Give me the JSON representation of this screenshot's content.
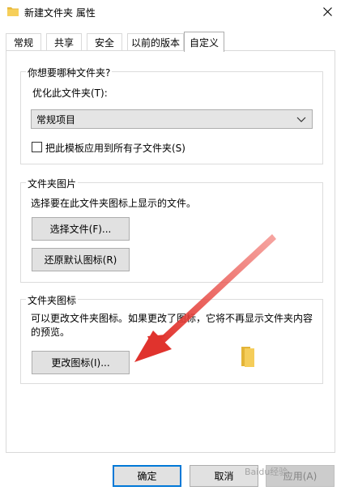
{
  "window": {
    "title": "新建文件夹 属性",
    "folder_icon": "folder-icon",
    "close_icon": "close-icon"
  },
  "tabs": [
    {
      "label": "常规",
      "active": false
    },
    {
      "label": "共享",
      "active": false
    },
    {
      "label": "安全",
      "active": false
    },
    {
      "label": "以前的版本",
      "active": false
    },
    {
      "label": "自定义",
      "active": true
    }
  ],
  "optimize": {
    "group_title": "你想要哪种文件夹?",
    "label": "优化此文件夹(T):",
    "selected": "常规项目",
    "checkbox_label": "把此模板应用到所有子文件夹(S)",
    "checked": false
  },
  "folder_pictures": {
    "group_title": "文件夹图片",
    "description": "选择要在此文件夹图标上显示的文件。",
    "choose_button": "选择文件(F)...",
    "restore_button": "还原默认图标(R)"
  },
  "folder_icons": {
    "group_title": "文件夹图标",
    "description_line1": "可以更改文件夹图标。如果更改了图标，它将不再显示文件夹内容",
    "description_line2": "的预览。",
    "change_button": "更改图标(I)...",
    "preview_icon": "folder-icon"
  },
  "footer": {
    "ok": "确定",
    "cancel": "取消",
    "apply": "应用(A)"
  },
  "overlay": {
    "watermark": "Baidu经验",
    "arrow_color": "#e8413b"
  }
}
